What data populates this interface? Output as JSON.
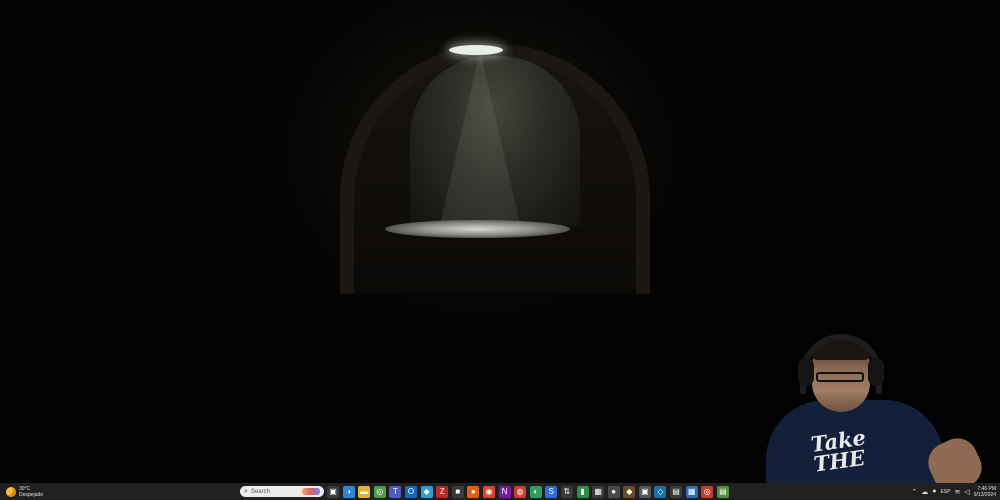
{
  "desktop": {
    "wallpaper": "dark stone cellar with light from skylight"
  },
  "taskbar": {
    "weather": {
      "temp": "30°C",
      "condition": "Despejado"
    },
    "search": {
      "label": "Search"
    },
    "icons": [
      {
        "name": "task-view-icon",
        "color": "#3a3a3a",
        "glyph": "▣"
      },
      {
        "name": "copilot-icon",
        "color": "#2b88d8",
        "glyph": "◑"
      },
      {
        "name": "file-explorer-icon",
        "color": "#e8b02a",
        "glyph": "▬"
      },
      {
        "name": "chrome-icon",
        "color": "#4c9d4c",
        "glyph": "◎"
      },
      {
        "name": "teams-icon",
        "color": "#5059c9",
        "glyph": "T"
      },
      {
        "name": "outlook-icon",
        "color": "#0f6cbd",
        "glyph": "O"
      },
      {
        "name": "app-icon",
        "color": "#2aa0d8",
        "glyph": "◆"
      },
      {
        "name": "filezilla-icon",
        "color": "#bf2a2a",
        "glyph": "Z"
      },
      {
        "name": "app2-icon",
        "color": "#3a3a3a",
        "glyph": "■"
      },
      {
        "name": "firefox-icon",
        "color": "#e66000",
        "glyph": "●"
      },
      {
        "name": "app3-icon",
        "color": "#d9452f",
        "glyph": "◉"
      },
      {
        "name": "onenote-icon",
        "color": "#7719aa",
        "glyph": "N"
      },
      {
        "name": "app4-icon",
        "color": "#d23a3a",
        "glyph": "◍"
      },
      {
        "name": "app5-icon",
        "color": "#2f9e5b",
        "glyph": "◐"
      },
      {
        "name": "app6-icon",
        "color": "#2d6fd6",
        "glyph": "S"
      },
      {
        "name": "network-icon",
        "color": "#3a3a3a",
        "glyph": "⇅"
      },
      {
        "name": "app7-icon",
        "color": "#2f8f46",
        "glyph": "▮"
      },
      {
        "name": "app8-icon",
        "color": "#3a3a3a",
        "glyph": "▦"
      },
      {
        "name": "app9-icon",
        "color": "#4a4a4a",
        "glyph": "●"
      },
      {
        "name": "app10-icon",
        "color": "#6b4a2a",
        "glyph": "◆"
      },
      {
        "name": "app11-icon",
        "color": "#555555",
        "glyph": "▣"
      },
      {
        "name": "app12-icon",
        "color": "#1d6fa5",
        "glyph": "◇"
      },
      {
        "name": "app13-icon",
        "color": "#3a3a3a",
        "glyph": "▤"
      },
      {
        "name": "app14-icon",
        "color": "#2a6fb5",
        "glyph": "▦"
      },
      {
        "name": "app15-icon",
        "color": "#c73b2b",
        "glyph": "◎"
      },
      {
        "name": "app16-icon",
        "color": "#4f8f3a",
        "glyph": "▤"
      }
    ],
    "tray": {
      "language": "ESP",
      "time": "7:46 PM",
      "date": "9/13/2024"
    }
  },
  "webcam": {
    "shirt_text": "Take THE"
  }
}
